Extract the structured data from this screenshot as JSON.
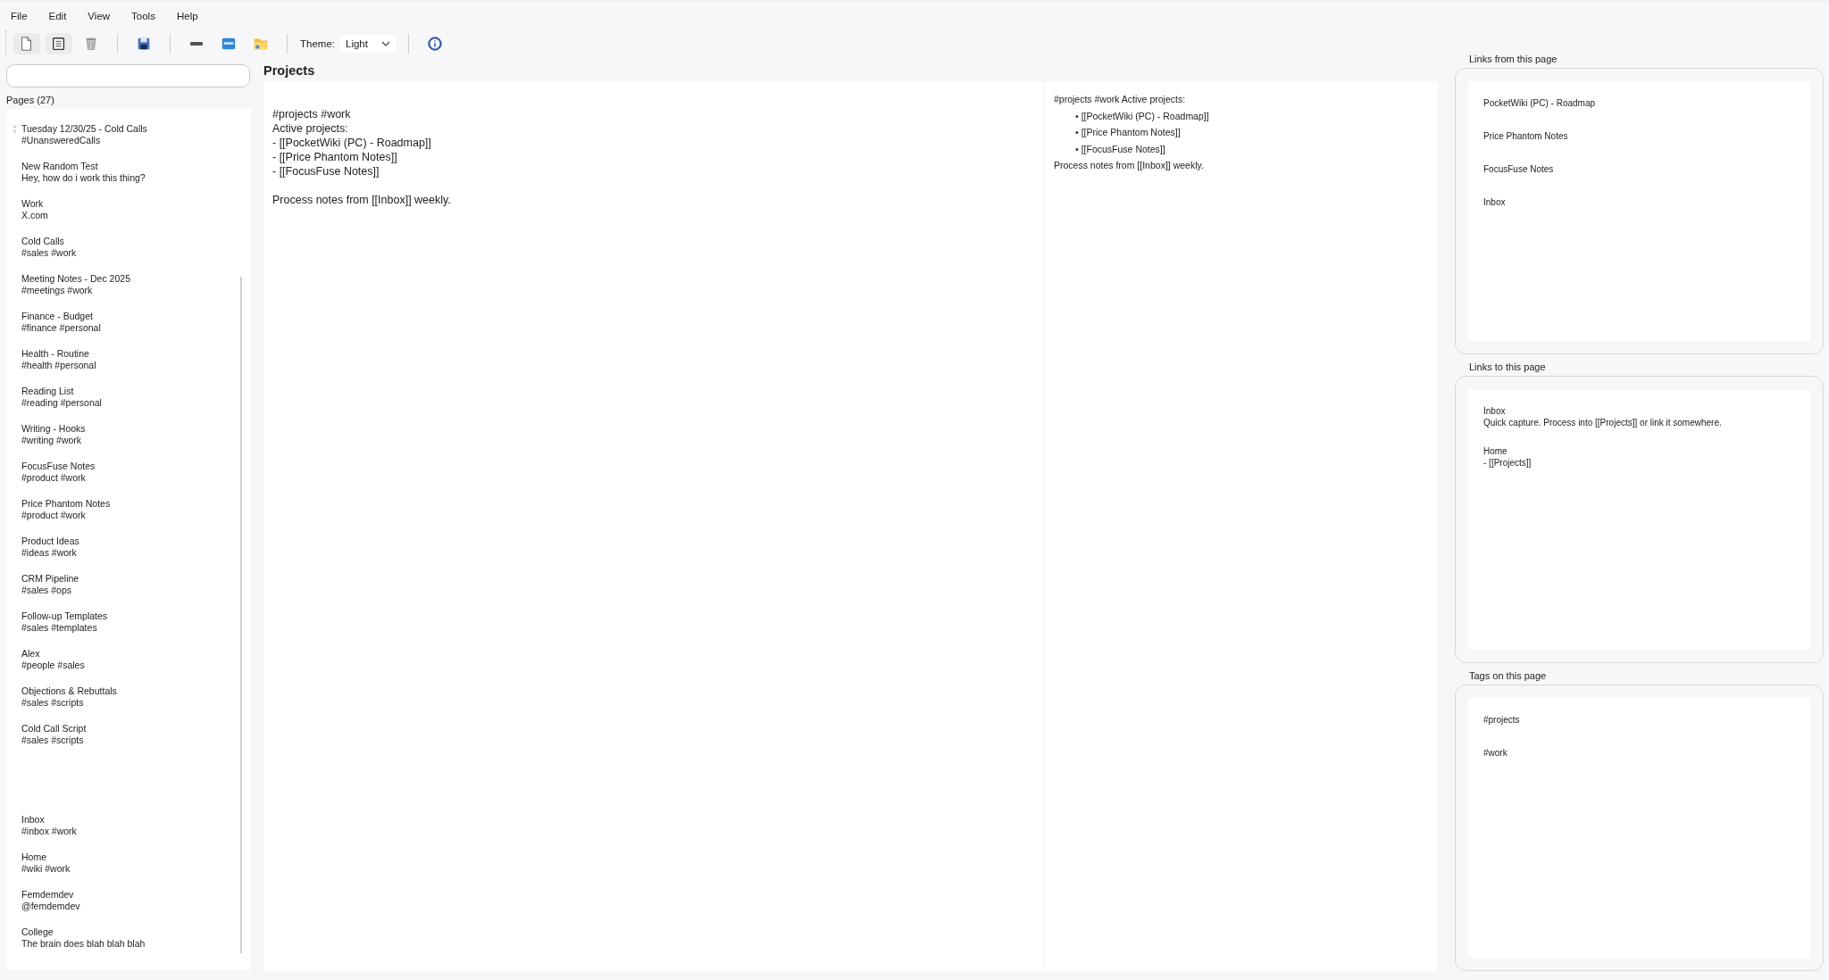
{
  "menu": [
    "File",
    "Edit",
    "View",
    "Tools",
    "Help"
  ],
  "toolbar": {
    "groups": [
      [
        {
          "kind": "new-page",
          "pressed": true
        },
        {
          "kind": "page-list",
          "pressed": true
        },
        {
          "kind": "delete",
          "pressed": false
        }
      ],
      [
        {
          "kind": "save",
          "pressed": false
        }
      ],
      [
        {
          "kind": "rule",
          "pressed": false
        },
        {
          "kind": "panel",
          "pressed": false
        },
        {
          "kind": "folder",
          "pressed": false
        }
      ]
    ],
    "theme_label": "Theme:",
    "theme_value": "Light",
    "info": {
      "kind": "info"
    }
  },
  "sidebar": {
    "search": {
      "kind": "text"
    },
    "pages_label": "Pages (27)",
    "pages": [
      {
        "title": "Tuesday 12/30/25 - Cold Calls",
        "subtitle": "#UnansweredCalls",
        "handle": true
      },
      {
        "title": "New Random Test",
        "subtitle": "Hey, how do i work this thing?",
        "handle": false
      },
      {
        "title": "Work",
        "subtitle": "X.com",
        "handle": false
      },
      {
        "title": "Cold Calls",
        "subtitle": "#sales #work",
        "handle": false
      },
      {
        "title": "Meeting Notes - Dec 2025",
        "subtitle": "#meetings #work",
        "handle": false
      },
      {
        "title": "Finance - Budget",
        "subtitle": "#finance #personal",
        "handle": false
      },
      {
        "title": "Health - Routine",
        "subtitle": "#health #personal",
        "handle": false
      },
      {
        "title": "Reading List",
        "subtitle": "#reading #personal",
        "handle": false
      },
      {
        "title": "Writing - Hooks",
        "subtitle": "#writing #work",
        "handle": false
      },
      {
        "title": "FocusFuse Notes",
        "subtitle": "#product #work",
        "handle": false
      },
      {
        "title": "Price Phantom Notes",
        "subtitle": "#product #work",
        "handle": false
      },
      {
        "title": "Product Ideas",
        "subtitle": "#ideas #work",
        "handle": false
      },
      {
        "title": "CRM Pipeline",
        "subtitle": "#sales #ops",
        "handle": false
      },
      {
        "title": "Follow-up Templates",
        "subtitle": "#sales #templates",
        "handle": false
      },
      {
        "title": "Alex",
        "subtitle": "#people #sales",
        "handle": false
      },
      {
        "title": "Objections & Rebuttals",
        "subtitle": "#sales #scripts",
        "handle": false
      },
      {
        "title": "Cold Call Script",
        "subtitle": "#sales #scripts",
        "handle": false
      },
      {
        "title": "Inbox",
        "subtitle": "#inbox #work",
        "handle": false,
        "gap_before": true
      },
      {
        "title": "Home",
        "subtitle": "#wiki #work",
        "handle": false
      },
      {
        "title": "Femdemdev",
        "subtitle": "@femdemdev",
        "handle": false
      },
      {
        "title": "College",
        "subtitle": "The brain does blah blah blah",
        "handle": false
      }
    ]
  },
  "page_title": "Projects",
  "editor": {
    "paragraphs": [
      [
        "#projects #work",
        "Active projects:",
        "- [[PocketWiki (PC) - Roadmap]]",
        "- [[Price Phantom Notes]]",
        "- [[FocusFuse Notes]]"
      ],
      [
        "Process notes from [[Inbox]] weekly."
      ]
    ]
  },
  "preview": {
    "intro": "#projects #work Active projects:",
    "bullet_marker": "•",
    "bullets": [
      "[[PocketWiki (PC) - Roadmap]]",
      "[[Price Phantom Notes]]",
      "[[FocusFuse Notes]]"
    ],
    "outro": "Process notes from [[Inbox]] weekly."
  },
  "links_from": {
    "title": "Links from this page",
    "items": [
      "PocketWiki (PC) - Roadmap",
      "Price Phantom Notes",
      "FocusFuse Notes",
      "Inbox"
    ]
  },
  "links_to": {
    "title": "Links to this page",
    "items": [
      {
        "title": "Inbox",
        "snippet": "Quick capture. Process into [[Projects]] or link it somewhere."
      },
      {
        "title": "Home",
        "snippet": "- [[Projects]]"
      }
    ]
  },
  "tags": {
    "title": "Tags on this page",
    "items": [
      "#projects",
      "#work"
    ]
  }
}
